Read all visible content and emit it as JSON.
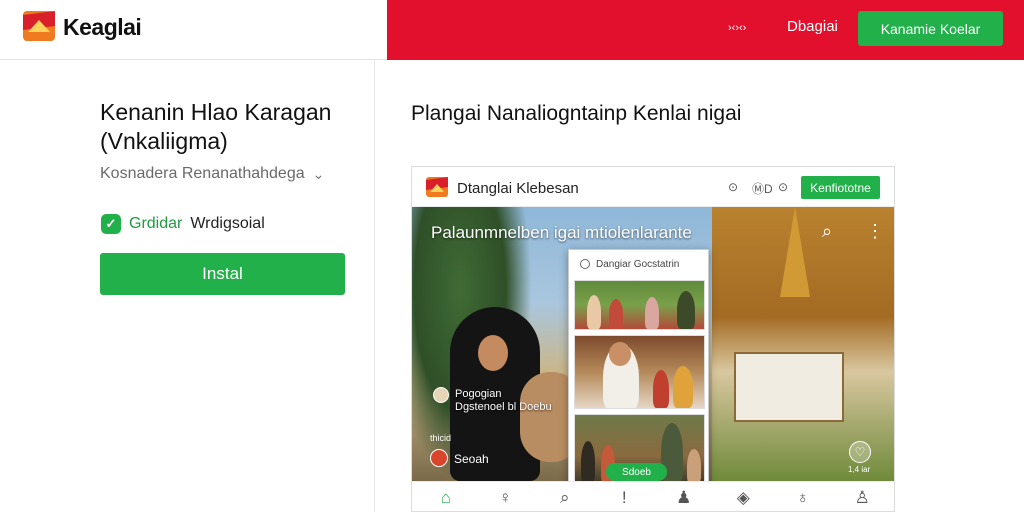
{
  "header": {
    "logo_text": "Keaglai",
    "small_text": "›‹›‹›",
    "link": "Dbagiai",
    "cta": "Kanamie Koelar"
  },
  "app": {
    "title": "Kenanin Hlao Karagan (Vnkaliigma)",
    "subtitle": "Kosnadera Renanathahdega",
    "verify_green": "Grdidar",
    "verify_dark": "Wrdigsoial",
    "install_label": "Instal"
  },
  "section": {
    "title": "Plangai Nanaliogntainp Kenlai nigai"
  },
  "preview": {
    "bar_title": "Dtanglai Klebesan",
    "bar_icon_1": "⊙",
    "bar_icon_2": "ⓂD",
    "bar_icon_3": "⊙",
    "bar_button": "Kenfiototne",
    "scene_caption": "Palaunmnelben igai mtiolenlarante",
    "person_name_line1": "Pogogian",
    "person_name_line2": "Dgstenoel  bl  Doebu",
    "tag": "thicid",
    "user2": "Seoah",
    "heart_count": "1,4 iar",
    "popup_header": "Dangiar Gocstatrin",
    "popup_button": "Sdoeb"
  },
  "icons": {
    "search": "⌕",
    "more": "⋮",
    "heart": "♡",
    "chevron": "⌄",
    "check": "✓",
    "nav": [
      "⌂",
      "♀",
      "⌕",
      "!",
      "♟",
      "◈",
      "♁",
      "♙"
    ]
  },
  "colors": {
    "brand_red": "#e2102c",
    "accent_green": "#22b04a"
  }
}
